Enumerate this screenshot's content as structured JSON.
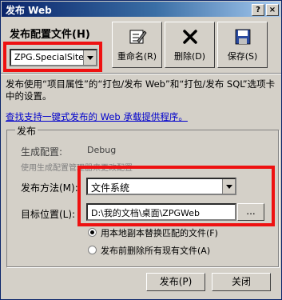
{
  "window": {
    "title": "发布 Web",
    "help_label": "?",
    "close_label": "×"
  },
  "profile": {
    "label": "发布配置文件(H)",
    "selected": "ZPG.SpecialSite"
  },
  "toolbar": {
    "rename": "重命名(R)",
    "delete": "删除(D)",
    "save": "保存(S)"
  },
  "description": "发布使用“项目属性”的“打包/发布 Web”和“打包/发布 SQL”选项卡中的设置。",
  "link_text": "查找支持一键式发布的 Web 承载提供程序。",
  "publish_group": {
    "title": "发布",
    "build_config_label": "生成配置:",
    "build_config_value": "Debug",
    "build_config_hint": "使用生成配置管理器来更改配置",
    "method_label": "发布方法(M):",
    "method_value": "文件系统",
    "target_label": "目标位置(L):",
    "target_value": "D:\\我的文档\\桌面\\ZPGWeb",
    "browse_label": "...",
    "radio_replace": "用本地副本替换匹配的文件(F)",
    "radio_delete": "发布前删除所有现有文件(A)"
  },
  "buttons": {
    "publish": "发布(P)",
    "close": "关闭"
  },
  "colors": {
    "highlight": "#ee1111",
    "title_bar": "#0a246a",
    "link": "#0000cc"
  }
}
